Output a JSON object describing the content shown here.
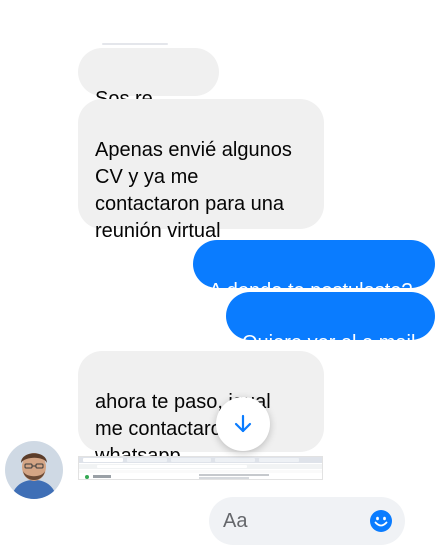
{
  "messages": {
    "m1": "Sos re crack",
    "m2": "Apenas envié algunos\nCV y ya me\ncontactaron para una\nreunión virtual",
    "m3": "A donde te postulaste?",
    "m4": "Quiero ver el e.mail",
    "m5": "ahora te paso, igual\nme contactaron por\nwhatsapp"
  },
  "composer": {
    "placeholder": "Aa"
  },
  "icons": {
    "scroll": "arrow-down-icon",
    "emoji": "smiley-icon"
  },
  "colors": {
    "outgoing": "#0a7cff",
    "incoming": "#f0f0f0",
    "composer": "#f0f2f5"
  }
}
